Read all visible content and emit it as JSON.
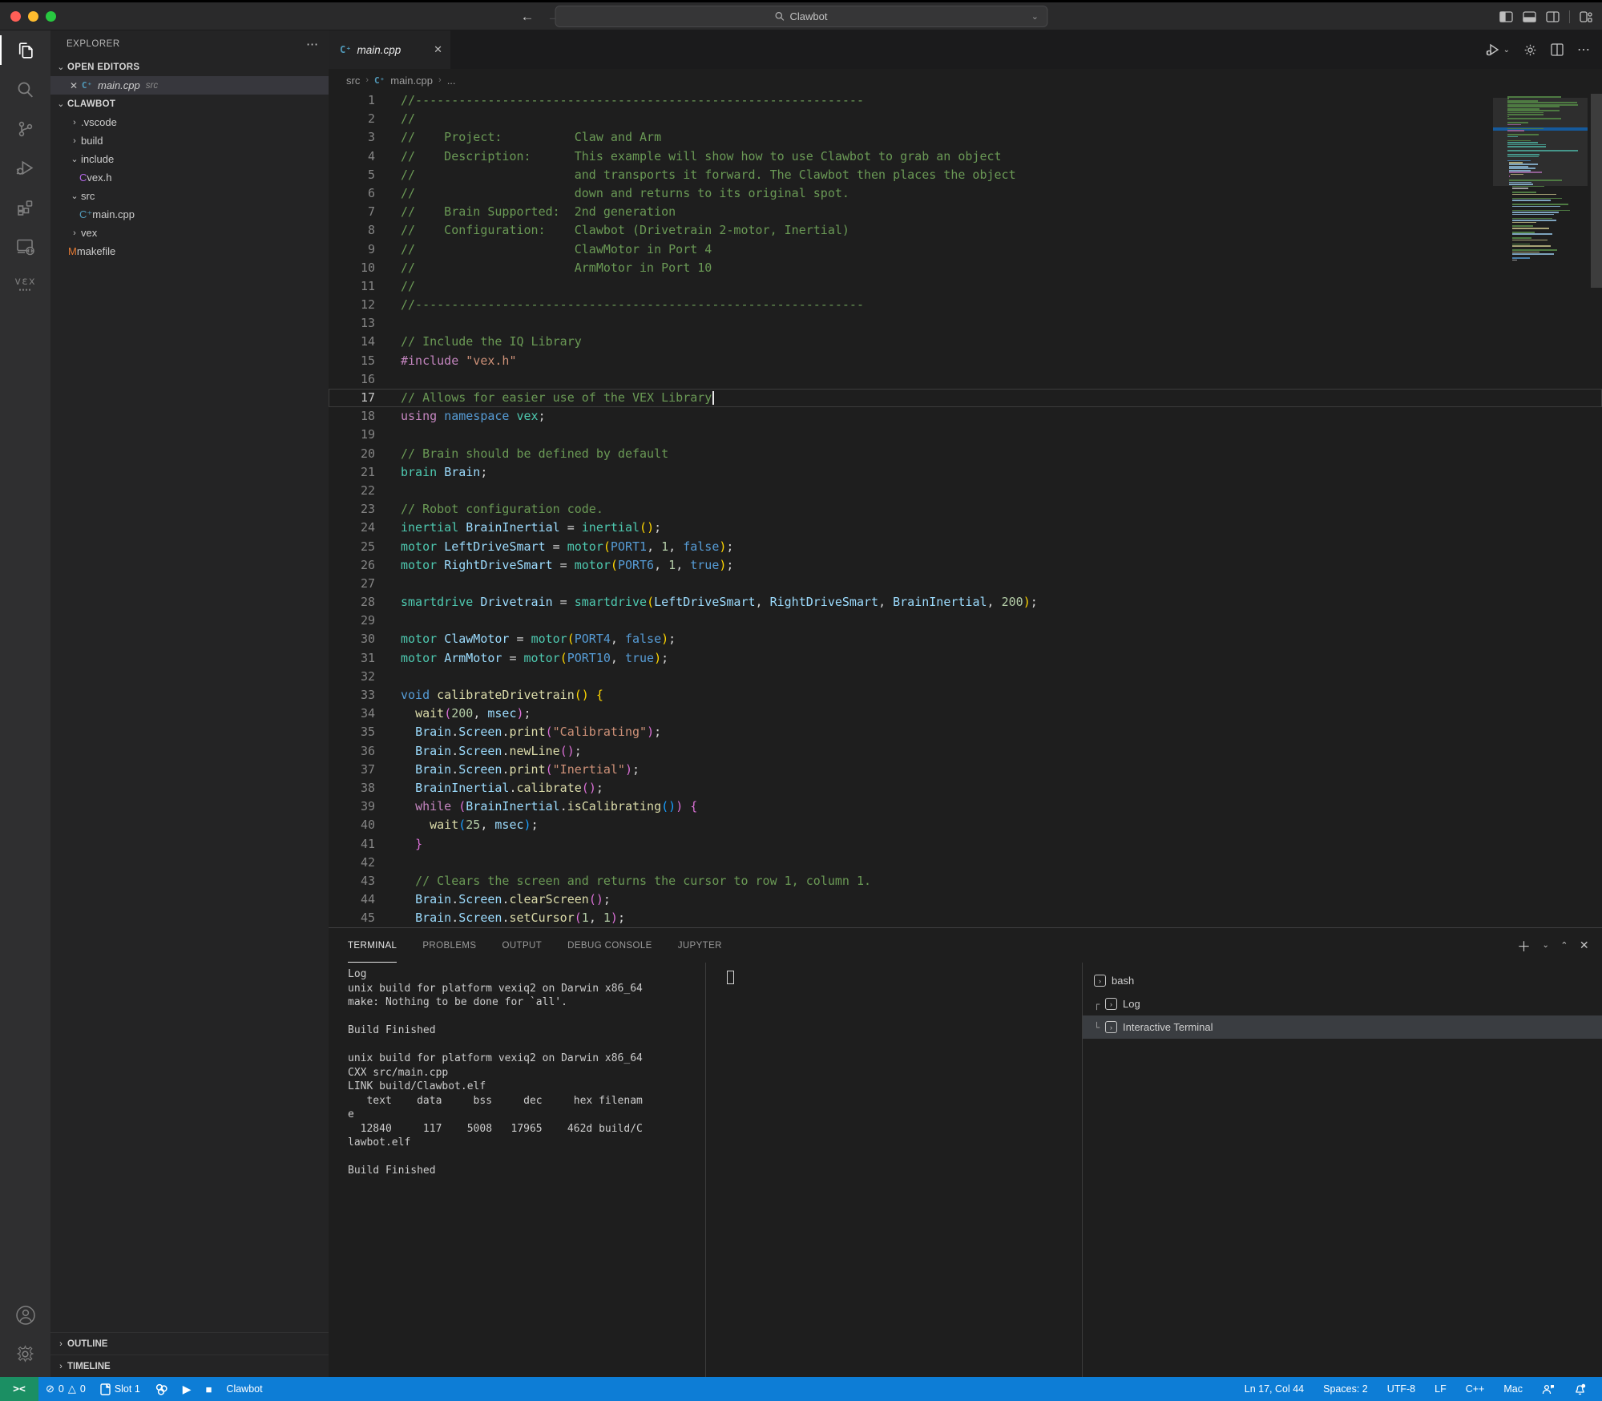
{
  "title_bar": {
    "search_value": "Clawbot"
  },
  "activity_bar": {
    "items": [
      {
        "name": "explorer",
        "active": true
      },
      {
        "name": "search",
        "active": false
      },
      {
        "name": "source-control",
        "active": false
      },
      {
        "name": "run-and-debug",
        "active": false
      },
      {
        "name": "extensions",
        "active": false
      },
      {
        "name": "remote-explorer",
        "active": false
      },
      {
        "name": "vex",
        "active": false
      }
    ],
    "bottom_items": [
      {
        "name": "account"
      },
      {
        "name": "settings"
      }
    ]
  },
  "sidebar": {
    "title": "EXPLORER",
    "open_editors_label": "OPEN EDITORS",
    "open_editors": [
      {
        "label": "main.cpp",
        "detail": "src",
        "selected": true,
        "icon": "cpp"
      }
    ],
    "workspace_label": "CLAWBOT",
    "files": [
      {
        "label": ".vscode",
        "kind": "folder",
        "expanded": false,
        "depth": 0
      },
      {
        "label": "build",
        "kind": "folder",
        "expanded": false,
        "depth": 0
      },
      {
        "label": "include",
        "kind": "folder",
        "expanded": true,
        "depth": 0
      },
      {
        "label": "vex.h",
        "kind": "file-c",
        "depth": 1
      },
      {
        "label": "src",
        "kind": "folder",
        "expanded": true,
        "depth": 0
      },
      {
        "label": "main.cpp",
        "kind": "file-cpp",
        "depth": 1
      },
      {
        "label": "vex",
        "kind": "folder",
        "expanded": false,
        "depth": 0
      },
      {
        "label": "makefile",
        "kind": "file-make",
        "depth": 0
      }
    ],
    "outline_label": "OUTLINE",
    "timeline_label": "TIMELINE"
  },
  "editor": {
    "tab_label": "main.cpp",
    "breadcrumbs": [
      "src",
      "main.cpp",
      "..."
    ],
    "active_line": 17,
    "lines": [
      {
        "n": 1,
        "t": [
          [
            "//--------------------------------------------------------------",
            "cm"
          ]
        ]
      },
      {
        "n": 2,
        "t": [
          [
            "//",
            "cm"
          ]
        ]
      },
      {
        "n": 3,
        "t": [
          [
            "//    Project:          Claw and Arm",
            "cm"
          ]
        ]
      },
      {
        "n": 4,
        "t": [
          [
            "//    Description:      This example will show how to use Clawbot to grab an object",
            "cm"
          ]
        ]
      },
      {
        "n": 5,
        "t": [
          [
            "//                      and transports it forward. The Clawbot then places the object",
            "cm"
          ]
        ]
      },
      {
        "n": 6,
        "t": [
          [
            "//                      down and returns to its original spot.",
            "cm"
          ]
        ]
      },
      {
        "n": 7,
        "t": [
          [
            "//    Brain Supported:  2nd generation",
            "cm"
          ]
        ]
      },
      {
        "n": 8,
        "t": [
          [
            "//    Configuration:    Clawbot (Drivetrain 2-motor, Inertial)",
            "cm"
          ]
        ]
      },
      {
        "n": 9,
        "t": [
          [
            "//                      ClawMotor in Port 4",
            "cm"
          ]
        ]
      },
      {
        "n": 10,
        "t": [
          [
            "//                      ArmMotor in Port 10",
            "cm"
          ]
        ]
      },
      {
        "n": 11,
        "t": [
          [
            "//",
            "cm"
          ]
        ]
      },
      {
        "n": 12,
        "t": [
          [
            "//--------------------------------------------------------------",
            "cm"
          ]
        ]
      },
      {
        "n": 13,
        "t": []
      },
      {
        "n": 14,
        "t": [
          [
            "// Include the IQ Library",
            "cm"
          ]
        ]
      },
      {
        "n": 15,
        "t": [
          [
            "#include",
            "ct"
          ],
          [
            " ",
            "pl"
          ],
          [
            "\"vex.h\"",
            "st"
          ]
        ]
      },
      {
        "n": 16,
        "t": []
      },
      {
        "n": 17,
        "cur": true,
        "t": [
          [
            "// Allows for easier use of the VEX Library",
            "cm"
          ]
        ]
      },
      {
        "n": 18,
        "t": [
          [
            "using",
            "ct"
          ],
          [
            " ",
            "pl"
          ],
          [
            "namespace",
            "kw"
          ],
          [
            " ",
            "pl"
          ],
          [
            "vex",
            "ty"
          ],
          [
            ";",
            "pl"
          ]
        ]
      },
      {
        "n": 19,
        "t": []
      },
      {
        "n": 20,
        "t": [
          [
            "// Brain should be defined by default",
            "cm"
          ]
        ]
      },
      {
        "n": 21,
        "t": [
          [
            "brain",
            "ty"
          ],
          [
            " ",
            "pl"
          ],
          [
            "Brain",
            "vr"
          ],
          [
            ";",
            "pl"
          ]
        ]
      },
      {
        "n": 22,
        "t": []
      },
      {
        "n": 23,
        "t": [
          [
            "// Robot configuration code.",
            "cm"
          ]
        ]
      },
      {
        "n": 24,
        "t": [
          [
            "inertial",
            "ty"
          ],
          [
            " ",
            "pl"
          ],
          [
            "BrainInertial",
            "vr"
          ],
          [
            " = ",
            "pl"
          ],
          [
            "inertial",
            "ty"
          ],
          [
            "(",
            "b1"
          ],
          [
            ")",
            "b1"
          ],
          [
            ";",
            "pl"
          ]
        ]
      },
      {
        "n": 25,
        "t": [
          [
            "motor",
            "ty"
          ],
          [
            " ",
            "pl"
          ],
          [
            "LeftDriveSmart",
            "vr"
          ],
          [
            " = ",
            "pl"
          ],
          [
            "motor",
            "ty"
          ],
          [
            "(",
            "b1"
          ],
          [
            "PORT1",
            "cs"
          ],
          [
            ", ",
            "pl"
          ],
          [
            "1",
            "nm"
          ],
          [
            ", ",
            "pl"
          ],
          [
            "false",
            "kw"
          ],
          [
            ")",
            "b1"
          ],
          [
            ";",
            "pl"
          ]
        ]
      },
      {
        "n": 26,
        "t": [
          [
            "motor",
            "ty"
          ],
          [
            " ",
            "pl"
          ],
          [
            "RightDriveSmart",
            "vr"
          ],
          [
            " = ",
            "pl"
          ],
          [
            "motor",
            "ty"
          ],
          [
            "(",
            "b1"
          ],
          [
            "PORT6",
            "cs"
          ],
          [
            ", ",
            "pl"
          ],
          [
            "1",
            "nm"
          ],
          [
            ", ",
            "pl"
          ],
          [
            "true",
            "kw"
          ],
          [
            ")",
            "b1"
          ],
          [
            ";",
            "pl"
          ]
        ]
      },
      {
        "n": 27,
        "t": []
      },
      {
        "n": 28,
        "t": [
          [
            "smartdrive",
            "ty"
          ],
          [
            " ",
            "pl"
          ],
          [
            "Drivetrain",
            "vr"
          ],
          [
            " = ",
            "pl"
          ],
          [
            "smartdrive",
            "ty"
          ],
          [
            "(",
            "b1"
          ],
          [
            "LeftDriveSmart",
            "vr"
          ],
          [
            ", ",
            "pl"
          ],
          [
            "RightDriveSmart",
            "vr"
          ],
          [
            ", ",
            "pl"
          ],
          [
            "BrainInertial",
            "vr"
          ],
          [
            ", ",
            "pl"
          ],
          [
            "200",
            "nm"
          ],
          [
            ")",
            "b1"
          ],
          [
            ";",
            "pl"
          ]
        ]
      },
      {
        "n": 29,
        "t": []
      },
      {
        "n": 30,
        "t": [
          [
            "motor",
            "ty"
          ],
          [
            " ",
            "pl"
          ],
          [
            "ClawMotor",
            "vr"
          ],
          [
            " = ",
            "pl"
          ],
          [
            "motor",
            "ty"
          ],
          [
            "(",
            "b1"
          ],
          [
            "PORT4",
            "cs"
          ],
          [
            ", ",
            "pl"
          ],
          [
            "false",
            "kw"
          ],
          [
            ")",
            "b1"
          ],
          [
            ";",
            "pl"
          ]
        ]
      },
      {
        "n": 31,
        "t": [
          [
            "motor",
            "ty"
          ],
          [
            " ",
            "pl"
          ],
          [
            "ArmMotor",
            "vr"
          ],
          [
            " = ",
            "pl"
          ],
          [
            "motor",
            "ty"
          ],
          [
            "(",
            "b1"
          ],
          [
            "PORT10",
            "cs"
          ],
          [
            ", ",
            "pl"
          ],
          [
            "true",
            "kw"
          ],
          [
            ")",
            "b1"
          ],
          [
            ";",
            "pl"
          ]
        ]
      },
      {
        "n": 32,
        "t": []
      },
      {
        "n": 33,
        "t": [
          [
            "void",
            "kw"
          ],
          [
            " ",
            "pl"
          ],
          [
            "calibrateDrivetrain",
            "fn"
          ],
          [
            "(",
            "b1"
          ],
          [
            ")",
            "b1"
          ],
          [
            " ",
            "pl"
          ],
          [
            "{",
            "b1"
          ]
        ]
      },
      {
        "n": 34,
        "t": [
          [
            "  ",
            "pl"
          ],
          [
            "wait",
            "fn"
          ],
          [
            "(",
            "b2"
          ],
          [
            "200",
            "nm"
          ],
          [
            ", ",
            "pl"
          ],
          [
            "msec",
            "vr"
          ],
          [
            ")",
            "b2"
          ],
          [
            ";",
            "pl"
          ]
        ]
      },
      {
        "n": 35,
        "t": [
          [
            "  ",
            "pl"
          ],
          [
            "Brain",
            "vr"
          ],
          [
            ".",
            "pl"
          ],
          [
            "Screen",
            "vr"
          ],
          [
            ".",
            "pl"
          ],
          [
            "print",
            "fn"
          ],
          [
            "(",
            "b2"
          ],
          [
            "\"Calibrating\"",
            "st"
          ],
          [
            ")",
            "b2"
          ],
          [
            ";",
            "pl"
          ]
        ]
      },
      {
        "n": 36,
        "t": [
          [
            "  ",
            "pl"
          ],
          [
            "Brain",
            "vr"
          ],
          [
            ".",
            "pl"
          ],
          [
            "Screen",
            "vr"
          ],
          [
            ".",
            "pl"
          ],
          [
            "newLine",
            "fn"
          ],
          [
            "(",
            "b2"
          ],
          [
            ")",
            "b2"
          ],
          [
            ";",
            "pl"
          ]
        ]
      },
      {
        "n": 37,
        "t": [
          [
            "  ",
            "pl"
          ],
          [
            "Brain",
            "vr"
          ],
          [
            ".",
            "pl"
          ],
          [
            "Screen",
            "vr"
          ],
          [
            ".",
            "pl"
          ],
          [
            "print",
            "fn"
          ],
          [
            "(",
            "b2"
          ],
          [
            "\"Inertial\"",
            "st"
          ],
          [
            ")",
            "b2"
          ],
          [
            ";",
            "pl"
          ]
        ]
      },
      {
        "n": 38,
        "t": [
          [
            "  ",
            "pl"
          ],
          [
            "BrainInertial",
            "vr"
          ],
          [
            ".",
            "pl"
          ],
          [
            "calibrate",
            "fn"
          ],
          [
            "(",
            "b2"
          ],
          [
            ")",
            "b2"
          ],
          [
            ";",
            "pl"
          ]
        ]
      },
      {
        "n": 39,
        "t": [
          [
            "  ",
            "pl"
          ],
          [
            "while",
            "ct"
          ],
          [
            " ",
            "pl"
          ],
          [
            "(",
            "b2"
          ],
          [
            "BrainInertial",
            "vr"
          ],
          [
            ".",
            "pl"
          ],
          [
            "isCalibrating",
            "fn"
          ],
          [
            "(",
            "b3"
          ],
          [
            ")",
            "b3"
          ],
          [
            ")",
            "b2"
          ],
          [
            " ",
            "pl"
          ],
          [
            "{",
            "b2"
          ]
        ]
      },
      {
        "n": 40,
        "t": [
          [
            "    ",
            "pl"
          ],
          [
            "wait",
            "fn"
          ],
          [
            "(",
            "b3"
          ],
          [
            "25",
            "nm"
          ],
          [
            ", ",
            "pl"
          ],
          [
            "msec",
            "vr"
          ],
          [
            ")",
            "b3"
          ],
          [
            ";",
            "pl"
          ]
        ]
      },
      {
        "n": 41,
        "t": [
          [
            "  ",
            "pl"
          ],
          [
            "}",
            "b2"
          ]
        ]
      },
      {
        "n": 42,
        "t": []
      },
      {
        "n": 43,
        "t": [
          [
            "  ",
            "pl"
          ],
          [
            "// Clears the screen and returns the cursor to row 1, column 1.",
            "cm"
          ]
        ]
      },
      {
        "n": 44,
        "t": [
          [
            "  ",
            "pl"
          ],
          [
            "Brain",
            "vr"
          ],
          [
            ".",
            "pl"
          ],
          [
            "Screen",
            "vr"
          ],
          [
            ".",
            "pl"
          ],
          [
            "clearScreen",
            "fn"
          ],
          [
            "(",
            "b2"
          ],
          [
            ")",
            "b2"
          ],
          [
            ";",
            "pl"
          ]
        ]
      },
      {
        "n": 45,
        "t": [
          [
            "  ",
            "pl"
          ],
          [
            "Brain",
            "vr"
          ],
          [
            ".",
            "pl"
          ],
          [
            "Screen",
            "vr"
          ],
          [
            ".",
            "pl"
          ],
          [
            "setCursor",
            "fn"
          ],
          [
            "(",
            "b2"
          ],
          [
            "1",
            "nm"
          ],
          [
            ", ",
            "pl"
          ],
          [
            "1",
            "nm"
          ],
          [
            ")",
            "b2"
          ],
          [
            ";",
            "pl"
          ]
        ]
      }
    ]
  },
  "panel": {
    "tabs": [
      "TERMINAL",
      "PROBLEMS",
      "OUTPUT",
      "DEBUG CONSOLE",
      "JUPYTER"
    ],
    "active_tab": "TERMINAL",
    "terminal_lines": [
      "Log",
      "unix build for platform vexiq2 on Darwin x86_64",
      "make: Nothing to be done for `all'.",
      "",
      "Build Finished",
      "",
      "unix build for platform vexiq2 on Darwin x86_64",
      "CXX src/main.cpp",
      "LINK build/Clawbot.elf",
      "   text    data     bss     dec     hex filenam",
      "e",
      "  12840     117    5008   17965    462d build/C",
      "lawbot.elf",
      "",
      "Build Finished"
    ],
    "sessions": [
      {
        "label": "bash",
        "depth": 0,
        "selected": false
      },
      {
        "label": "Log",
        "depth": 1,
        "guide": "┌",
        "selected": false
      },
      {
        "label": "Interactive Terminal",
        "depth": 1,
        "guide": "└",
        "selected": true
      }
    ]
  },
  "status_bar": {
    "remote_glyph": "><",
    "errors": "0",
    "warnings": "0",
    "slot": "Slot 1",
    "app": "Clawbot",
    "cursor": "Ln 17, Col 44",
    "indent": "Spaces: 2",
    "encoding": "UTF-8",
    "eol": "LF",
    "language": "C++",
    "platform": "Mac"
  }
}
